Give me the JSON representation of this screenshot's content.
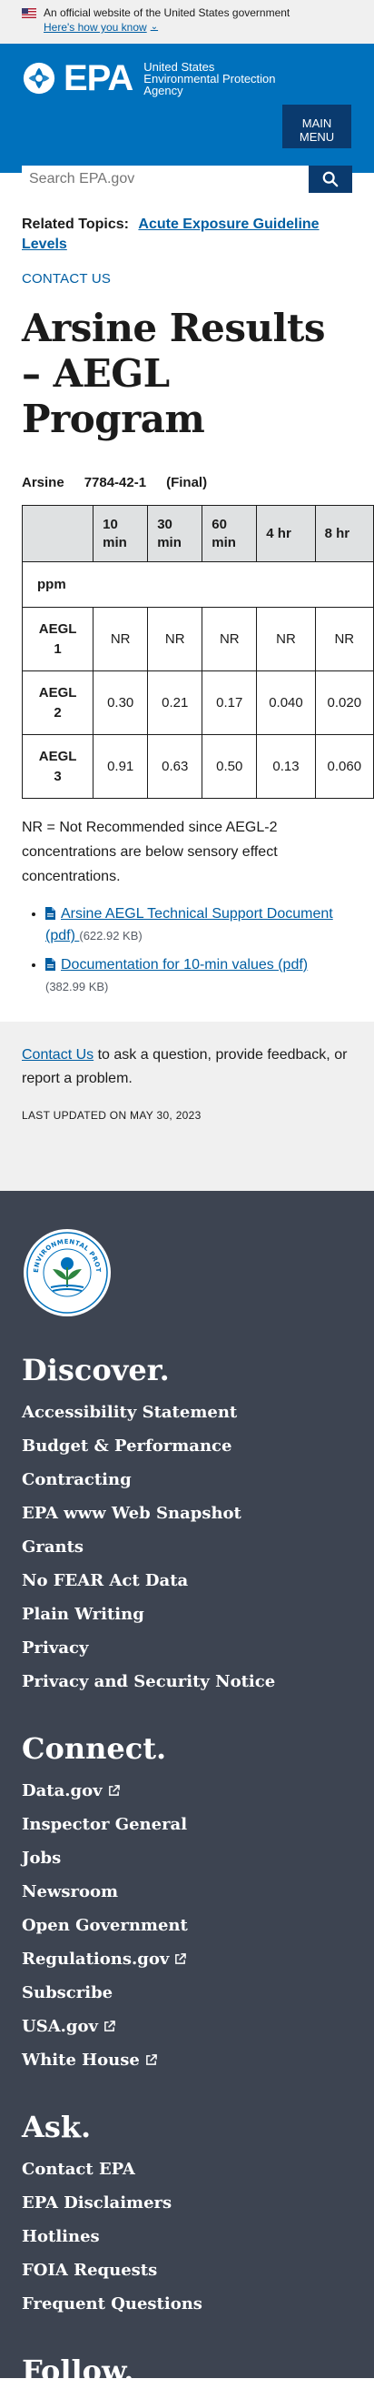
{
  "gov_banner": {
    "text": "An official website of the United States government",
    "link": "Here's how you know"
  },
  "header": {
    "logo_word": "EPA",
    "logo_sub_1": "United States",
    "logo_sub_2": "Environmental Protection",
    "logo_sub_3": "Agency",
    "menu_line1": "MAIN",
    "menu_line2": "MENU",
    "search_placeholder": "Search EPA.gov"
  },
  "main": {
    "related_label": "Related Topics:",
    "related_link": "Acute Exposure Guideline Levels",
    "contact_us": "CONTACT US",
    "title": "Arsine Results – AEGL Program",
    "chemical": {
      "name": "Arsine",
      "cas": "7784-42-1",
      "status": "(Final)"
    },
    "table": {
      "headers": [
        "10 min",
        "30 min",
        "60 min",
        "4 hr",
        "8 hr"
      ],
      "unit": "ppm",
      "rows": [
        {
          "level": "AEGL 1",
          "values": [
            "NR",
            "NR",
            "NR",
            "NR",
            "NR"
          ]
        },
        {
          "level": "AEGL 2",
          "values": [
            "0.30",
            "0.21",
            "0.17",
            "0.040",
            "0.020"
          ]
        },
        {
          "level": "AEGL 3",
          "values": [
            "0.91",
            "0.63",
            "0.50",
            "0.13",
            "0.060"
          ]
        }
      ]
    },
    "note": "NR = Not Recommended since AEGL-2 concentrations are below sensory effect concentrations.",
    "docs": [
      {
        "label": "Arsine AEGL Technical Support Document (pdf)",
        "size": "(622.92 KB)"
      },
      {
        "label": "Documentation for 10-min values (pdf)",
        "size": "(382.99 KB)"
      }
    ]
  },
  "contact_box": {
    "link": "Contact Us",
    "text": " to ask a question, provide feedback, or report a problem.",
    "updated": "LAST UPDATED ON MAY 30, 2023"
  },
  "footer": {
    "seal_text": "UNITED STATES ENVIRONMENTAL PROTECTION AGENCY",
    "discover": {
      "heading": "Discover.",
      "items": [
        "Accessibility Statement",
        "Budget & Performance",
        "Contracting",
        "EPA www Web Snapshot",
        "Grants",
        "No FEAR Act Data",
        "Plain Writing",
        "Privacy",
        "Privacy and Security Notice"
      ]
    },
    "connect": {
      "heading": "Connect.",
      "items": [
        "Data.gov",
        "Inspector General",
        "Jobs",
        "Newsroom",
        "Open Government",
        "Regulations.gov",
        "Subscribe",
        "USA.gov",
        "White House"
      ]
    },
    "ask": {
      "heading": "Ask.",
      "items": [
        "Contact EPA",
        "EPA Disclaimers",
        "Hotlines",
        "FOIA Requests",
        "Frequent Questions"
      ]
    },
    "follow": {
      "heading": "Follow."
    }
  },
  "icons": {
    "flag": "us-flag-icon",
    "chevron": "chevron-down-icon",
    "search": "search-icon",
    "pdf": "file-icon",
    "external": "external-link-icon"
  },
  "colors": {
    "header_blue": "#0071bc",
    "dark_blue": "#0a3a6e",
    "link": "#005ea2",
    "footer_bg": "#3d4451",
    "table_header": "#dfe1e2"
  }
}
